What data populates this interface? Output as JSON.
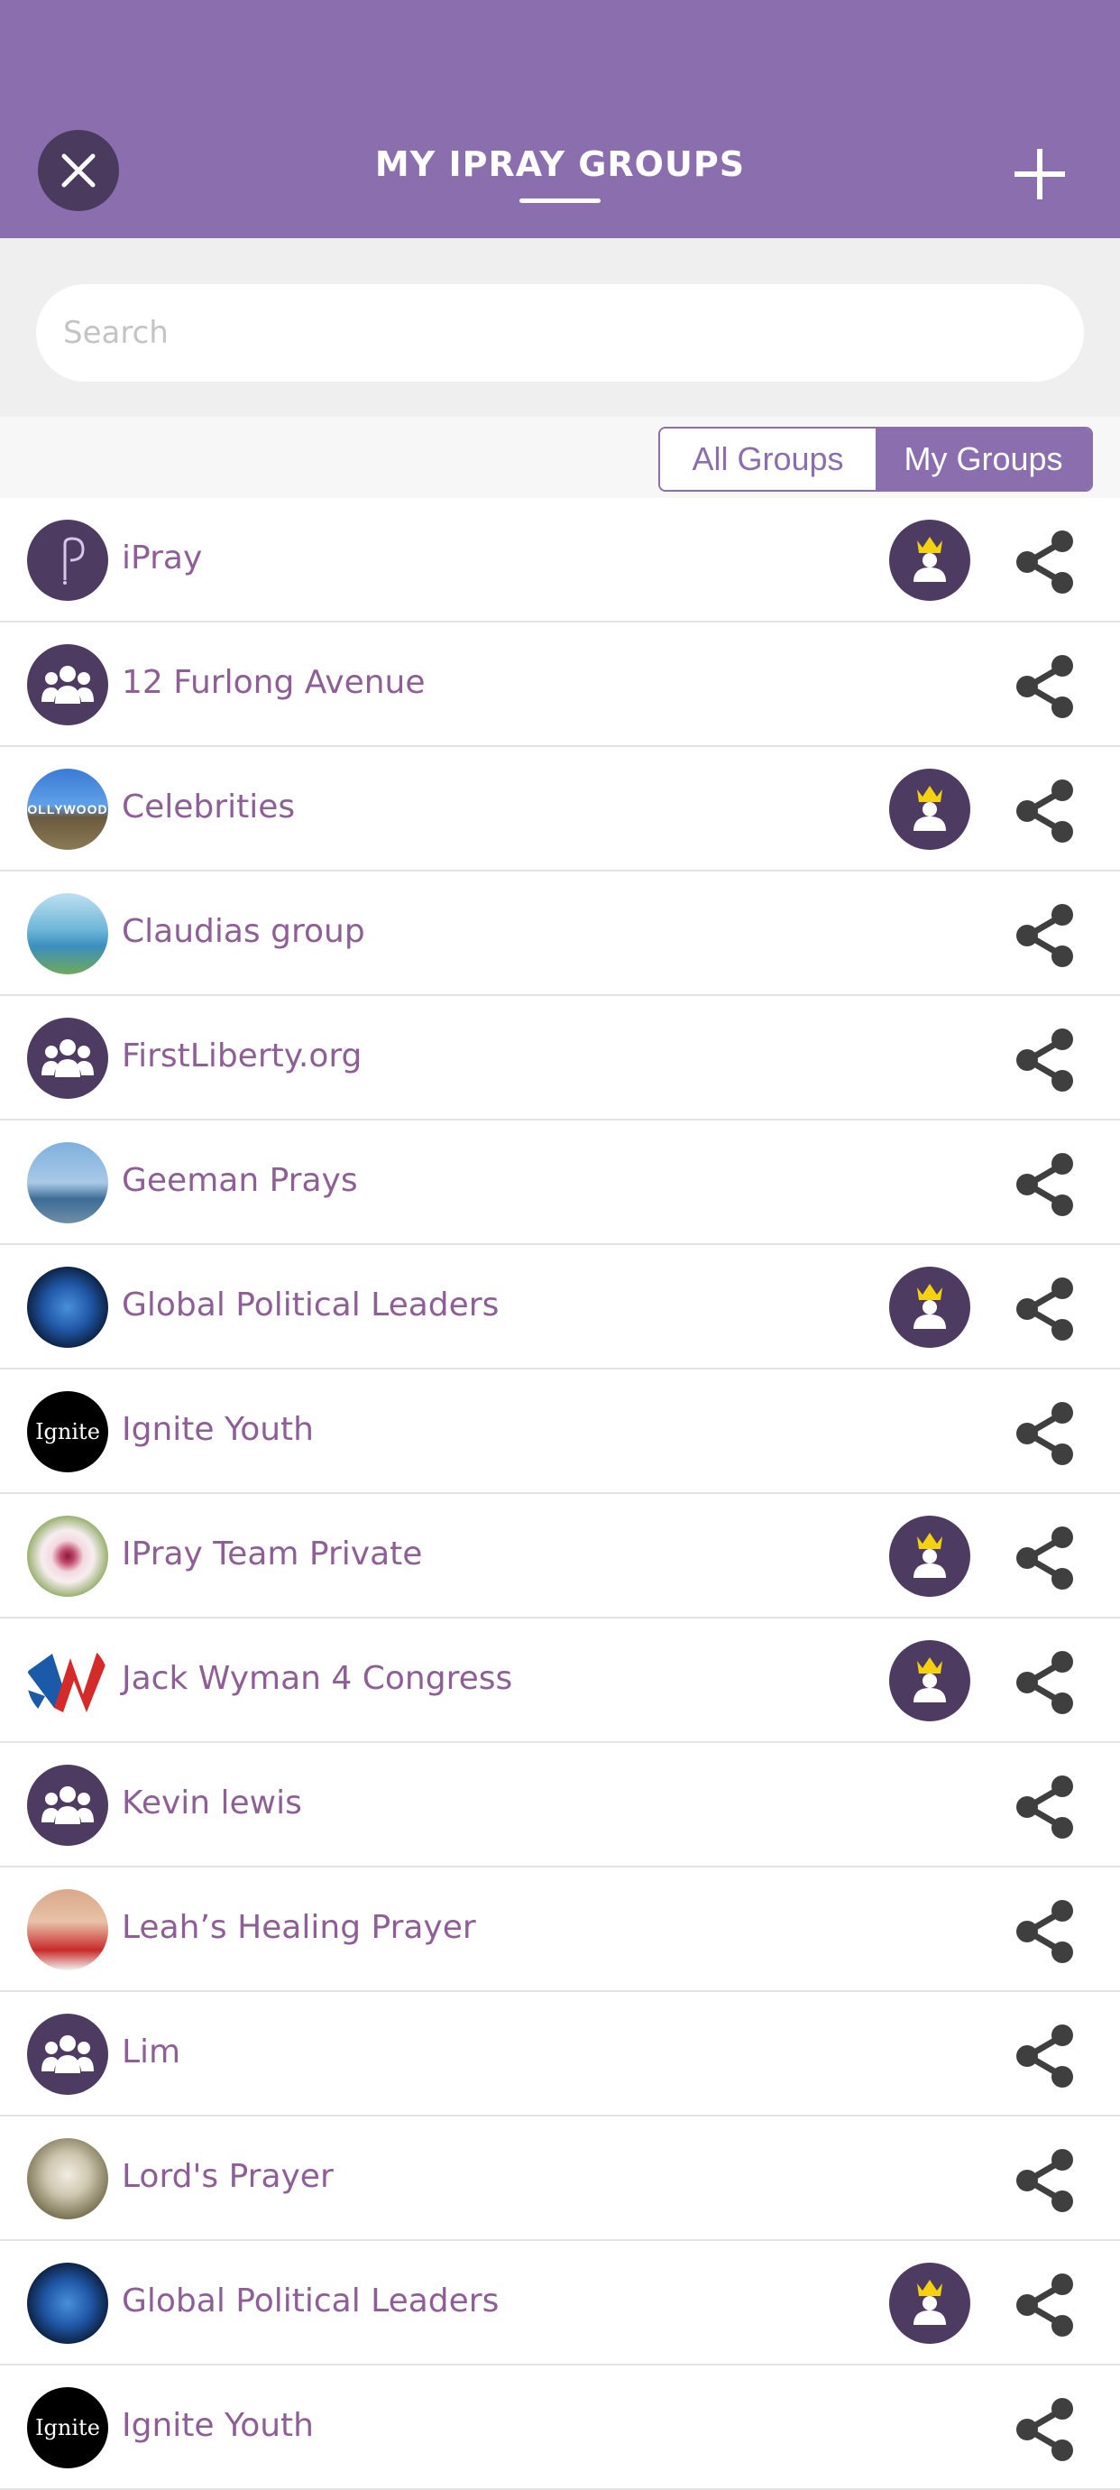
{
  "header": {
    "title": "MY IPRAY GROUPS",
    "close_icon": "close-icon",
    "add_icon": "plus-icon",
    "bg_color": "#8b6eae"
  },
  "search": {
    "placeholder": "Search",
    "value": ""
  },
  "segment": {
    "options": [
      "All Groups",
      "My Groups"
    ],
    "selected": "My Groups"
  },
  "colors": {
    "accent": "#8b6eae",
    "name_text": "#8e5f96",
    "badge_bg": "#4e3b62",
    "share_icon": "#3f3f3f",
    "crown": "#f5d20f"
  },
  "groups": [
    {
      "name": "iPray",
      "avatar": "ipray-logo",
      "admin": true
    },
    {
      "name": "12 Furlong Avenue",
      "avatar": "group-icon",
      "admin": false
    },
    {
      "name": "Celebrities",
      "avatar": "hollywood-photo",
      "admin": true
    },
    {
      "name": "Claudias group",
      "avatar": "coast-photo",
      "admin": false
    },
    {
      "name": "FirstLiberty.org",
      "avatar": "group-icon",
      "admin": false
    },
    {
      "name": "Geeman Prays",
      "avatar": "sea-photo",
      "admin": false
    },
    {
      "name": "Global Political Leaders",
      "avatar": "earth-photo",
      "admin": true
    },
    {
      "name": "Ignite Youth",
      "avatar": "ignite-logo",
      "admin": false
    },
    {
      "name": "IPray Team Private",
      "avatar": "flower-photo",
      "admin": true
    },
    {
      "name": "Jack Wyman 4 Congress",
      "avatar": "wyman-logo",
      "admin": true
    },
    {
      "name": "Kevin lewis",
      "avatar": "group-icon",
      "admin": false
    },
    {
      "name": "Leah’s Healing Prayer",
      "avatar": "child-photo",
      "admin": false
    },
    {
      "name": "Lim",
      "avatar": "group-icon",
      "admin": false
    },
    {
      "name": "Lord's Prayer",
      "avatar": "rose-photo",
      "admin": false
    },
    {
      "name": "Global Political Leaders",
      "avatar": "earth-photo",
      "admin": true
    },
    {
      "name": "Ignite Youth",
      "avatar": "ignite-logo",
      "admin": false
    }
  ]
}
